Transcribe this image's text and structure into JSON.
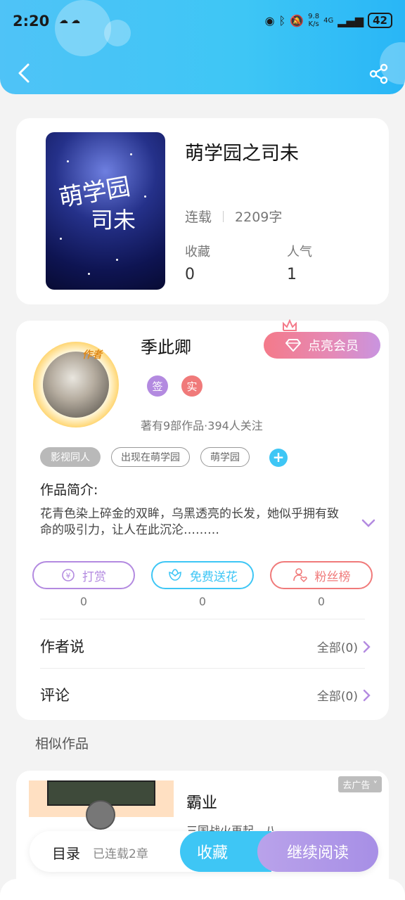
{
  "status_bar": {
    "time": "2:20",
    "speed_top": "9.8",
    "speed_bottom": "K/s",
    "network": "4G",
    "battery": "42"
  },
  "book": {
    "title": "萌学园之司未",
    "status": "连载",
    "word_count": "2209字",
    "favorites_label": "收藏",
    "favorites_value": "0",
    "popularity_label": "人气",
    "popularity_value": "1",
    "cover_title": "萌学园",
    "cover_subtitle": "司未"
  },
  "author": {
    "name": "季此卿",
    "badge": "作者",
    "vip_button": "点亮会员",
    "sign_badge": "签",
    "real_badge": "实",
    "sub_info": "著有9部作品·394人关注"
  },
  "tags": [
    "影视同人",
    "出现在萌学园",
    "萌学园"
  ],
  "intro": {
    "label": "作品简介:",
    "text": "花青色染上碎金的双眸，乌黑透亮的长发，她似乎拥有致命的吸引力，让人在此沉沦………"
  },
  "actions": [
    {
      "label": "打赏",
      "value": "0"
    },
    {
      "label": "免费送花",
      "value": "0"
    },
    {
      "label": "粉丝榜",
      "value": "0"
    }
  ],
  "author_says": {
    "label": "作者说",
    "right": "全部(0)"
  },
  "comments": {
    "label": "评论",
    "right": "全部(0)"
  },
  "similar": {
    "title": "相似作品",
    "item_title": "霸业",
    "item_desc": "三国战火再起，八",
    "ad_label": "去广告"
  },
  "bottom_bar": {
    "toc": "目录",
    "toc_sub": "已连载2章",
    "favorite": "收藏",
    "continue": "继续阅读"
  },
  "colors": {
    "header": "#3ec6f5",
    "accent_purple": "#b38ae0",
    "accent_cyan": "#3ec6f5",
    "accent_red": "#f07a7a"
  }
}
